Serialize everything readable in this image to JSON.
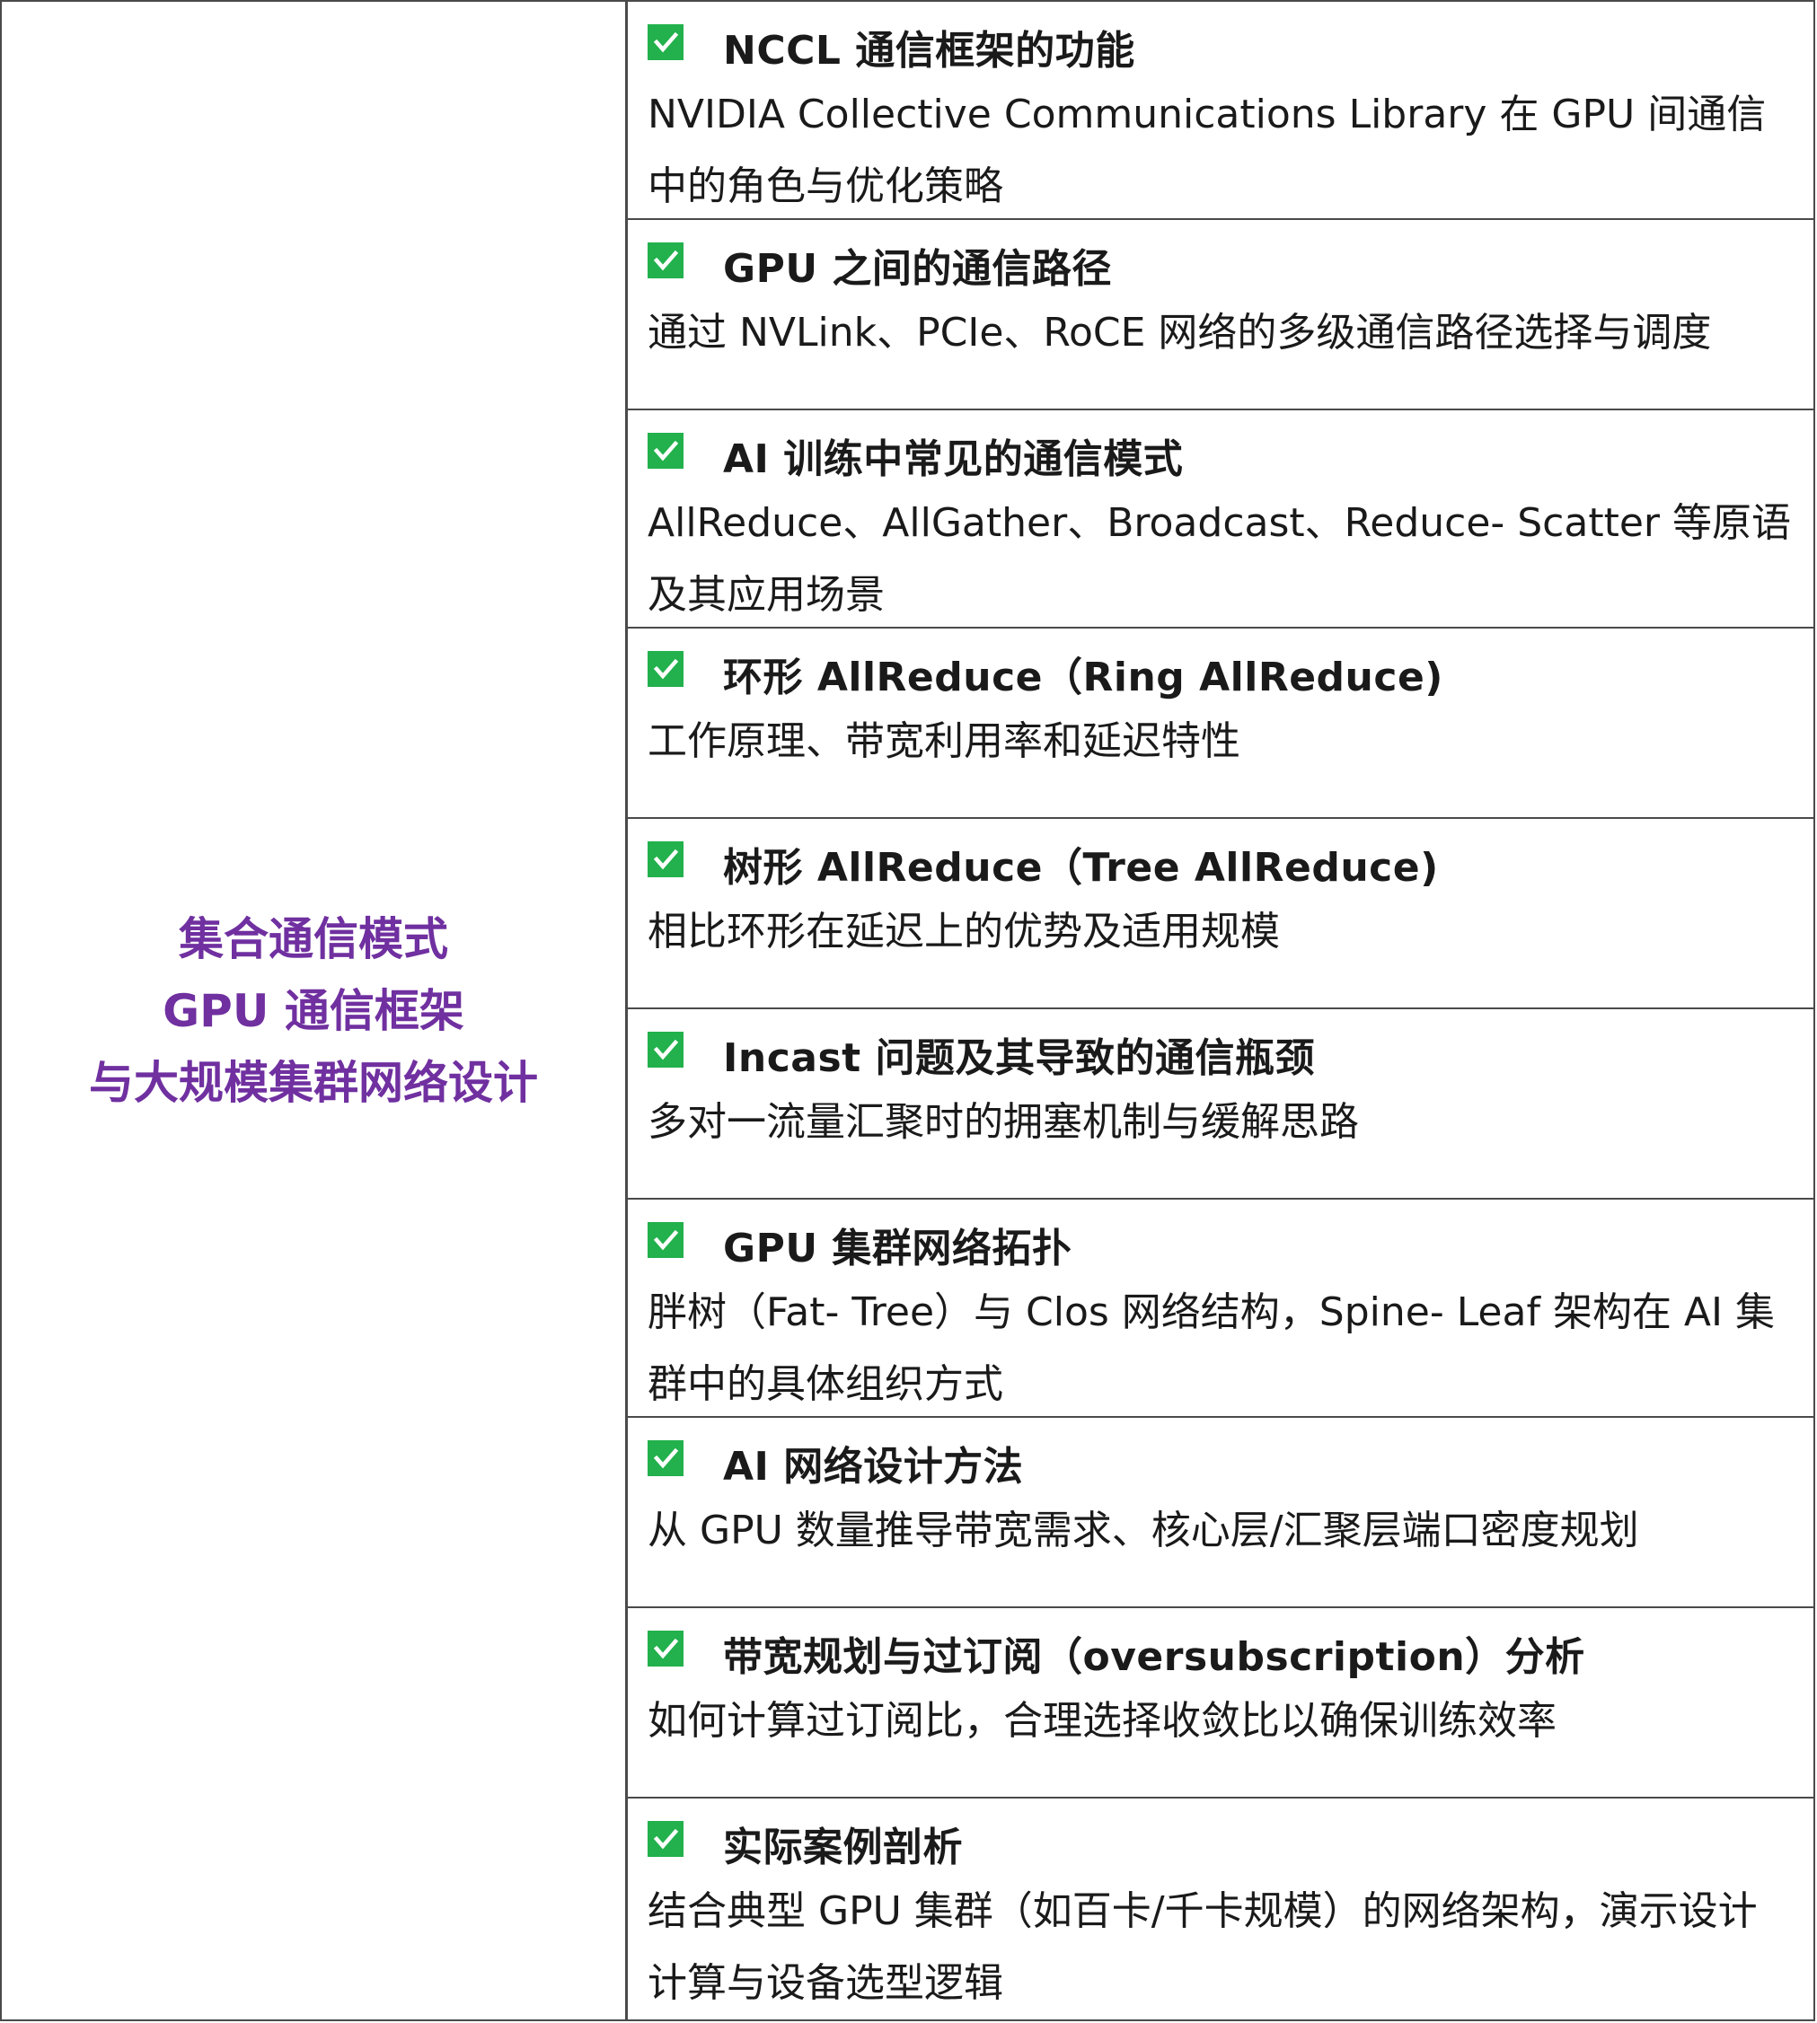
{
  "left": {
    "title_lines": [
      "集合通信模式",
      "GPU 通信框架",
      "与大规模集群网络设计"
    ],
    "color": "#7030a0"
  },
  "check_color": "#22b14c",
  "items": [
    {
      "title": "NCCL 通信框架的功能",
      "desc": "NVIDIA Collective Communications Library 在 GPU 间通信中的角色与优化策略",
      "icon": "checkbox-checked-icon"
    },
    {
      "title": "GPU 之间的通信路径",
      "desc": "通过 NVLink、PCIe、RoCE 网络的多级通信路径选择与调度",
      "icon": "checkbox-checked-icon"
    },
    {
      "title": "AI 训练中常见的通信模式",
      "desc": "AllReduce、AllGather、Broadcast、Reduce- Scatter 等原语及其应用场景",
      "icon": "checkbox-checked-icon"
    },
    {
      "title": "环形 AllReduce（Ring AllReduce)",
      "desc": "工作原理、带宽利用率和延迟特性",
      "icon": "checkbox-checked-icon"
    },
    {
      "title": "树形 AllReduce（Tree AllReduce)",
      "desc": "相比环形在延迟上的优势及适用规模",
      "icon": "checkbox-checked-icon"
    },
    {
      "title": "Incast 问题及其导致的通信瓶颈",
      "desc": "多对一流量汇聚时的拥塞机制与缓解思路",
      "icon": "checkbox-checked-icon"
    },
    {
      "title": "GPU 集群网络拓扑",
      "desc": "胖树（Fat- Tree）与 Clos 网络结构，Spine- Leaf 架构在 AI 集群中的具体组织方式",
      "icon": "checkbox-checked-icon"
    },
    {
      "title": "AI 网络设计方法",
      "desc": "从 GPU 数量推导带宽需求、核心层/汇聚层端口密度规划",
      "icon": "checkbox-checked-icon"
    },
    {
      "title": "带宽规划与过订阅（oversubscription）分析",
      "desc": "如何计算过订阅比，合理选择收敛比以确保训练效率",
      "icon": "checkbox-checked-icon"
    },
    {
      "title": "实际案例剖析",
      "desc": "结合典型 GPU 集群（如百卡/千卡规模）的网络架构，演示设计计算与设备选型逻辑",
      "icon": "checkbox-checked-icon"
    }
  ]
}
